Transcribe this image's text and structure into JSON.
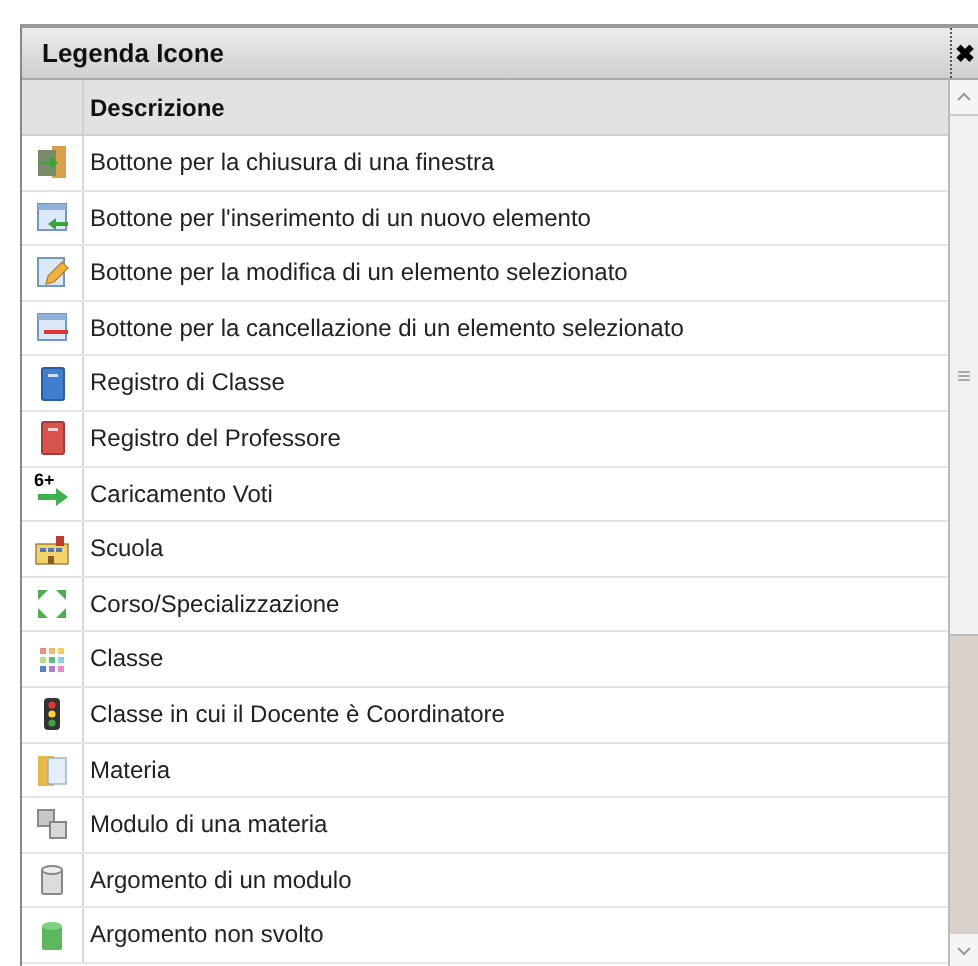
{
  "window": {
    "title": "Legenda Icone",
    "close": "✖"
  },
  "table": {
    "columns": [
      "Descrizione"
    ],
    "rows": [
      {
        "kind": "door",
        "text": "Bottone per la chiusura di una finestra"
      },
      {
        "kind": "insert",
        "text": "Bottone per l'inserimento di un nuovo elemento"
      },
      {
        "kind": "edit",
        "text": "Bottone per la modifica di un elemento selezionato"
      },
      {
        "kind": "delete",
        "text": "Bottone per la cancellazione di un elemento selezionato"
      },
      {
        "kind": "book-blue",
        "text": "Registro di Classe"
      },
      {
        "kind": "book-red",
        "text": "Registro del Professore"
      },
      {
        "kind": "grades",
        "text": "Caricamento Voti",
        "badge": "6+"
      },
      {
        "kind": "school",
        "text": "Scuola"
      },
      {
        "kind": "arrows",
        "text": "Corso/Specializzazione"
      },
      {
        "kind": "dots",
        "text": "Classe"
      },
      {
        "kind": "traffic",
        "text": "Classe in cui il Docente è Coordinatore"
      },
      {
        "kind": "folder",
        "text": "Materia"
      },
      {
        "kind": "blocks",
        "text": "Modulo di una materia"
      },
      {
        "kind": "block",
        "text": "Argomento di un modulo"
      },
      {
        "kind": "green-block",
        "text": "Argomento non svolto"
      }
    ]
  }
}
